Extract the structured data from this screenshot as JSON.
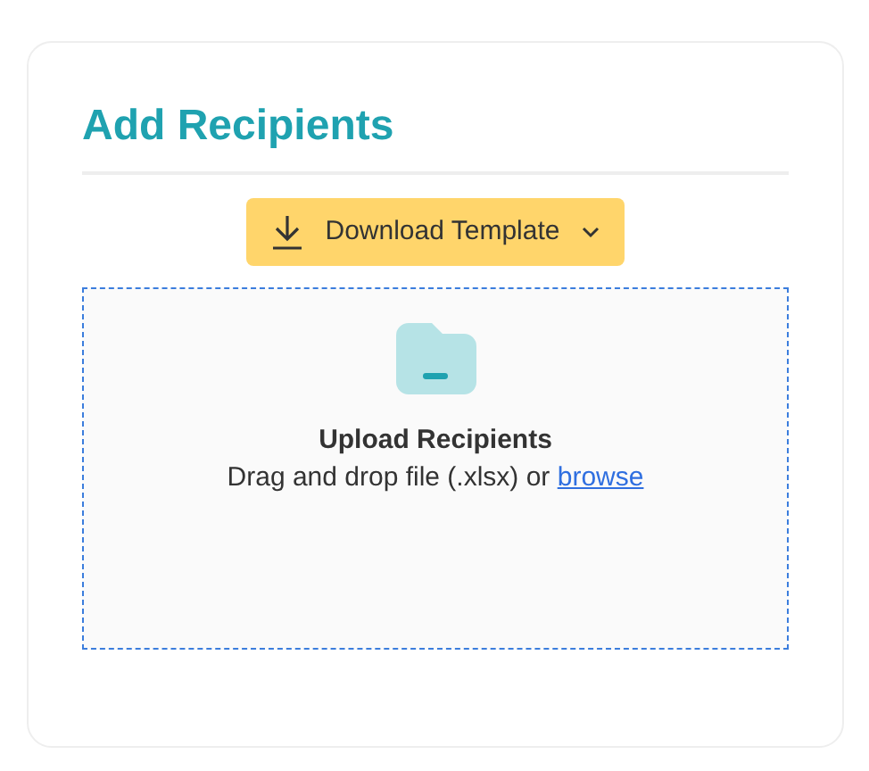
{
  "title": "Add Recipients",
  "download_button": {
    "label": "Download Template"
  },
  "dropzone": {
    "heading": "Upload Recipients",
    "hint": "Drag and drop file (.xlsx) or",
    "link": "browse"
  }
}
